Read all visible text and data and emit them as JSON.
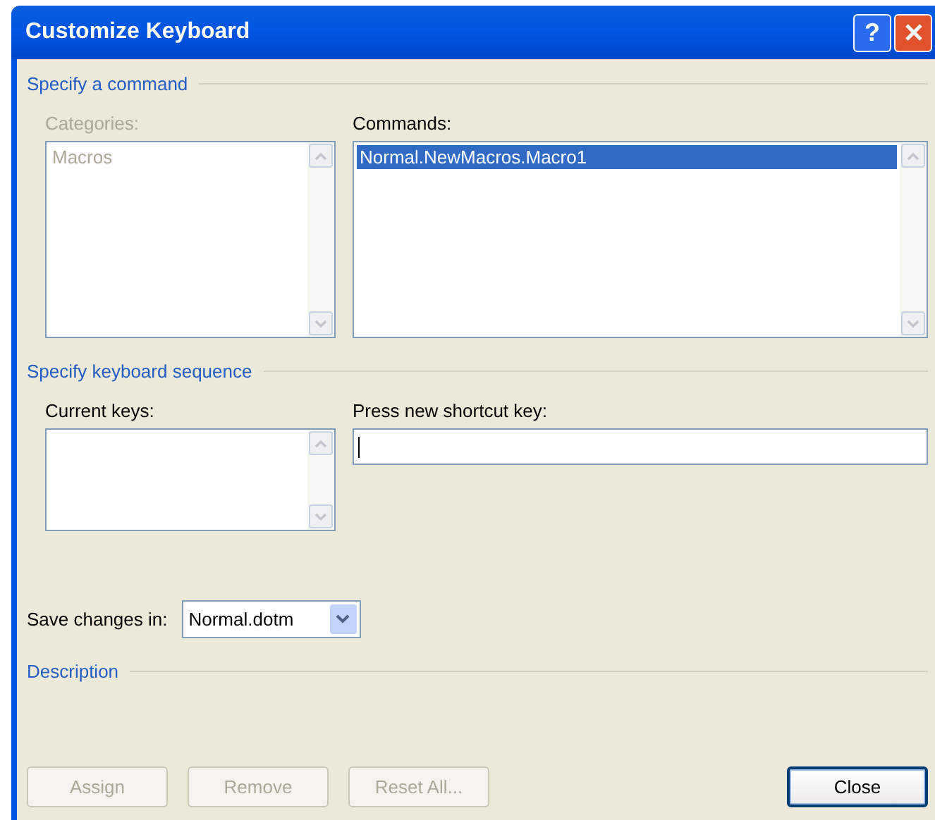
{
  "window": {
    "title": "Customize Keyboard",
    "help_button": "?"
  },
  "command_section": {
    "title": "Specify a command",
    "categories": {
      "label": "Categories:",
      "disabled": true,
      "items": [
        {
          "text": "Macros",
          "selected": false
        }
      ]
    },
    "commands": {
      "label": "Commands:",
      "disabled": false,
      "items": [
        {
          "text": "Normal.NewMacros.Macro1",
          "selected": true
        }
      ]
    }
  },
  "keyboard_section": {
    "title": "Specify keyboard sequence",
    "current_keys": {
      "label": "Current keys:"
    },
    "new_shortcut": {
      "label": "Press new shortcut key:",
      "focused": true
    }
  },
  "save_changes": {
    "label": "Save changes in:",
    "value": "Normal.dotm"
  },
  "description_section": {
    "title": "Description"
  },
  "buttons": [
    {
      "label": "Assign",
      "disabled": true,
      "default": false
    },
    {
      "label": "Remove",
      "disabled": true,
      "default": false
    },
    {
      "label": "Reset All...",
      "disabled": true,
      "default": false
    },
    {
      "label": "Close",
      "disabled": false,
      "default": true
    }
  ]
}
